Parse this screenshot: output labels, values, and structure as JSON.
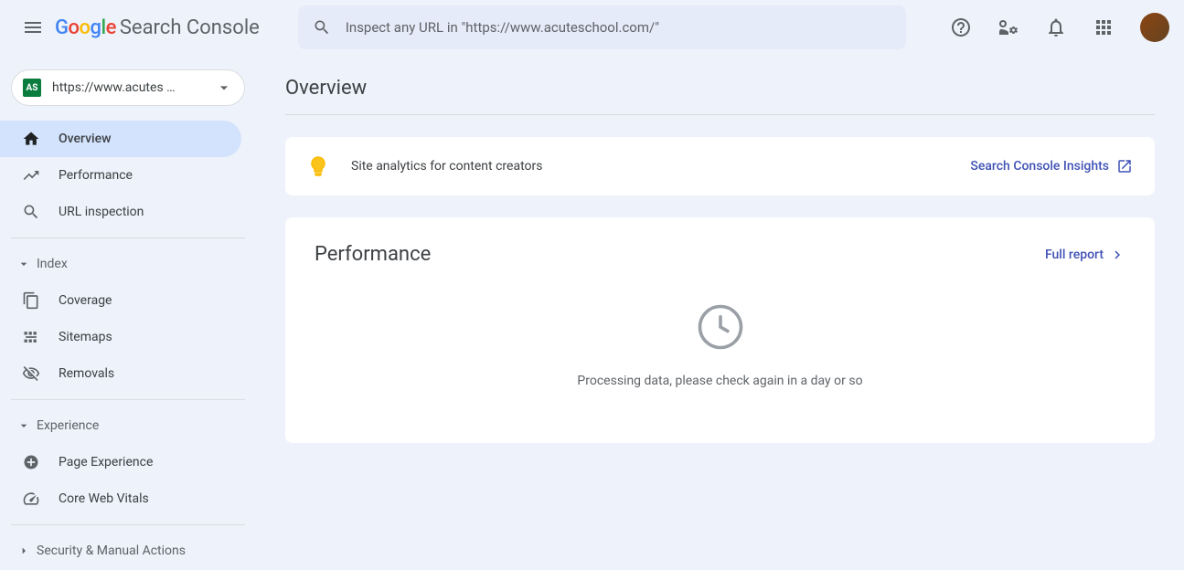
{
  "header": {
    "logo_suffix": "Search Console",
    "search_placeholder": "Inspect any URL in \"https://www.acuteschool.com/\""
  },
  "sidebar": {
    "property_label": "https://www.acutes …",
    "property_icon_text": "AS",
    "items_main": [
      {
        "label": "Overview"
      },
      {
        "label": "Performance"
      },
      {
        "label": "URL inspection"
      }
    ],
    "section_index": "Index",
    "items_index": [
      {
        "label": "Coverage"
      },
      {
        "label": "Sitemaps"
      },
      {
        "label": "Removals"
      }
    ],
    "section_experience": "Experience",
    "items_experience": [
      {
        "label": "Page Experience"
      },
      {
        "label": "Core Web Vitals"
      }
    ],
    "section_security": "Security & Manual Actions"
  },
  "main": {
    "page_title": "Overview",
    "insight_text": "Site analytics for content creators",
    "insight_link": "Search Console Insights",
    "performance": {
      "title": "Performance",
      "full_report": "Full report",
      "empty_message": "Processing data, please check again in a day or so"
    }
  }
}
